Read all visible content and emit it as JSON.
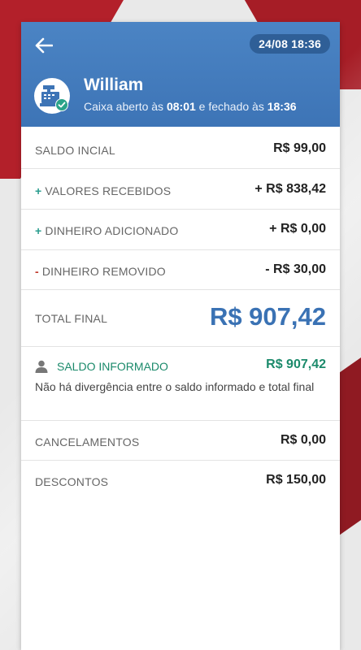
{
  "header": {
    "datetime": "24/08 18:36",
    "user_name": "William",
    "status_prefix": "Caixa aberto às ",
    "open_time": "08:01",
    "status_middle": " e fechado às ",
    "close_time": "18:36"
  },
  "rows": {
    "saldo_inicial": {
      "label": "SALDO INCIAL",
      "value": "R$ 99,00"
    },
    "valores_recebidos": {
      "sign": "+",
      "label": "VALORES RECEBIDOS",
      "value": "+ R$ 838,42"
    },
    "dinheiro_adicionado": {
      "sign": "+",
      "label": "DINHEIRO ADICIONADO",
      "value": "+ R$ 0,00"
    },
    "dinheiro_removido": {
      "sign": "-",
      "label": "DINHEIRO REMOVIDO",
      "value": "- R$ 30,00"
    },
    "total_final": {
      "label": "TOTAL FINAL",
      "value": "R$ 907,42"
    },
    "saldo_informado": {
      "label": "SALDO INFORMADO",
      "value": "R$ 907,42",
      "note": "Não há divergência entre o saldo informado e total final"
    },
    "cancelamentos": {
      "label": "CANCELAMENTOS",
      "value": "R$ 0,00"
    },
    "descontos": {
      "label": "DESCONTOS",
      "value": "R$ 150,00"
    }
  },
  "icons": {
    "back": "arrow-left-icon",
    "register": "cash-register-icon",
    "check": "check-circle-icon",
    "person": "person-icon"
  },
  "colors": {
    "header_blue": "#4b84c4",
    "total_blue": "#3a72b4",
    "green": "#1b8a6b",
    "brand_red": "#b3202a"
  }
}
